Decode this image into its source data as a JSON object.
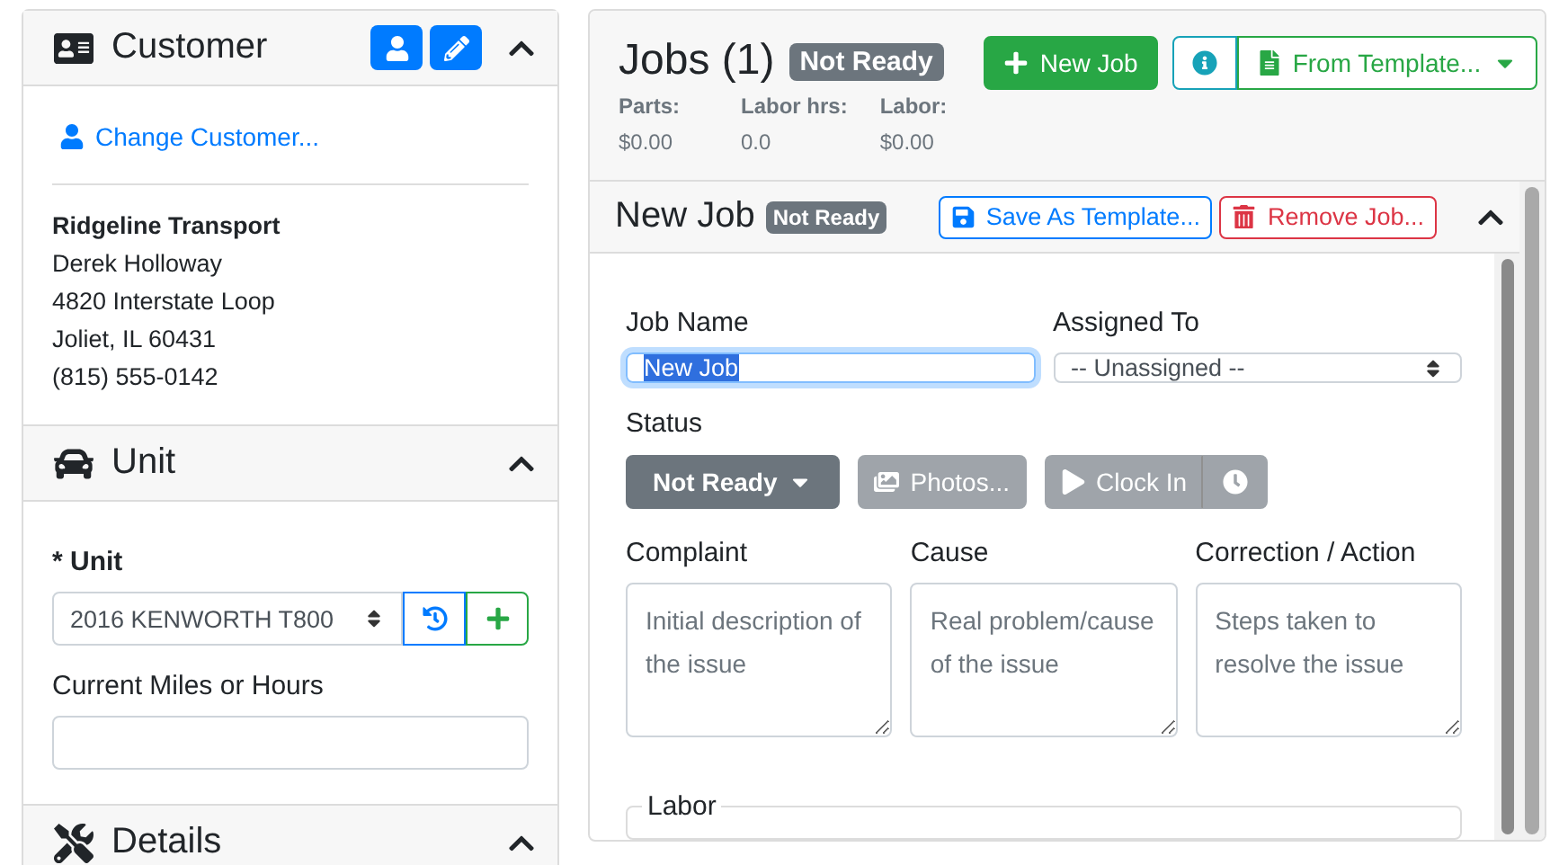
{
  "customer": {
    "title": "Customer",
    "expanded": true,
    "change_link": "Change Customer...",
    "company": "Ridgeline Transport",
    "contact": "Derek Holloway",
    "address": "4820 Interstate Loop",
    "city": "Joliet, IL 60431",
    "phone": "(815) 555-0142"
  },
  "unit": {
    "title": "Unit",
    "expanded": true,
    "unit_label": "* Unit",
    "unit_value": "2016 KENWORTH T800",
    "miles_label": "Current Miles or Hours"
  },
  "details": {
    "title": "Details",
    "expanded": true
  },
  "jobs": {
    "title": "Jobs (1)",
    "status_badge": "Not Ready",
    "new_job_button": "New Job",
    "template_button": "From Template...",
    "totals": [
      {
        "label": "Parts:",
        "value": "$0.00"
      },
      {
        "label": "Labor hrs:",
        "value": "0.0"
      },
      {
        "label": "Labor:",
        "value": "$0.00"
      }
    ]
  },
  "job": {
    "title": "New Job",
    "status_badge": "Not Ready",
    "expanded": true,
    "save_template_button": "Save As Template...",
    "remove_button": "Remove Job...",
    "job_name": {
      "label": "Job Name",
      "value": "New Job",
      "text_selected": true
    },
    "assigned": {
      "label": "Assigned To",
      "value": "-- Unassigned --"
    },
    "status_label": "Status",
    "status_button": "Not Ready",
    "photos_button": {
      "label": "Photos...",
      "disabled": true
    },
    "clock_in_button": {
      "label": "Clock In",
      "disabled": true
    },
    "notes": [
      {
        "label": "Complaint",
        "placeholder": "Initial description of the issue"
      },
      {
        "label": "Cause",
        "placeholder": "Real problem/cause of the issue"
      },
      {
        "label": "Correction / Action",
        "placeholder": "Steps taken to resolve the issue"
      }
    ],
    "labor_legend": "Labor"
  }
}
